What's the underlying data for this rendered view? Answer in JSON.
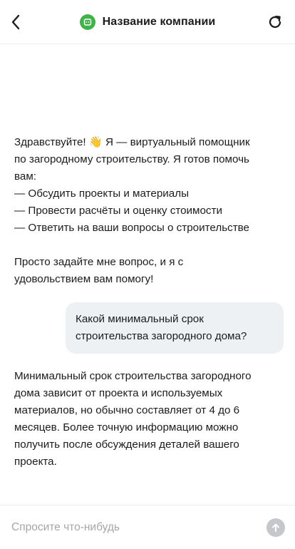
{
  "header": {
    "title": "Название компании",
    "back_icon": "chevron-left-icon",
    "refresh_icon": "refresh-icon",
    "logo_icon": "bot-icon",
    "logo_color": "#3fb24a"
  },
  "messages": [
    {
      "role": "assistant",
      "paragraphs": [
        [
          "Здравствуйте! 👋 Я — виртуальный помощник",
          "по загородному строительству. Я готов помочь",
          "вам:",
          "— Обсудить проекты и материалы",
          "— Провести расчёты и оценку стоимости",
          "— Ответить на ваши вопросы о строительстве"
        ],
        [
          "Просто задайте мне вопрос, и я с",
          "удовольствием вам помогу!"
        ]
      ]
    },
    {
      "role": "user",
      "lines": [
        "Какой минимальный срок",
        "строительства загородного дома?"
      ]
    },
    {
      "role": "assistant",
      "lines": [
        "Минимальный срок строительства загородного",
        "дома зависит от проекта и используемых",
        "материалов, но обычно составляет от 4 до 6",
        "месяцев. Более точную информацию можно",
        "получить после обсуждения деталей вашего",
        "проекта."
      ]
    }
  ],
  "composer": {
    "placeholder": "Спросите что-нибудь",
    "value": "",
    "send_icon": "arrow-up-icon",
    "send_color": "#c4c7cc"
  },
  "colors": {
    "user_bubble": "#eef1f4",
    "divider": "#ececec"
  }
}
